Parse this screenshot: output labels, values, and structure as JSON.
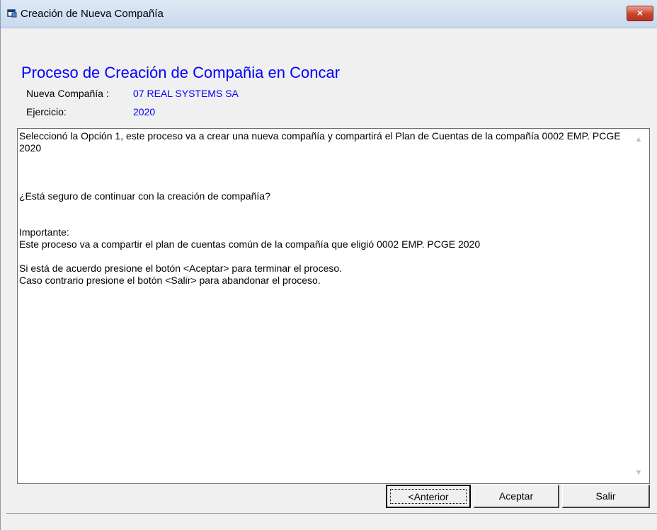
{
  "window": {
    "title": "Creación de Nueva Compañía",
    "close_label": "×"
  },
  "header": {
    "title": "Proceso de Creación de Compañia en Concar",
    "company_label": "Nueva Compañía :",
    "company_value": "07 REAL SYSTEMS SA",
    "year_label": "Ejercicio:",
    "year_value": "2020"
  },
  "message": {
    "text": "Seleccionó la Opción 1, este proceso va a crear una nueva compañía y compartirá el Plan de Cuentas de la compañía 0002 EMP. PCGE 2020\n\n\n\n¿Está seguro de continuar con la creación de compañía?\n\n\nImportante:\nEste proceso va a compartir el plan de cuentas común de la compañía que eligió 0002 EMP. PCGE 2020\n\nSi está de acuerdo presione el botón <Aceptar> para terminar el proceso.\nCaso contrario presione el botón <Salir> para abandonar el proceso."
  },
  "buttons": {
    "previous": "<Anterior",
    "accept": "Aceptar",
    "exit": "Salir"
  }
}
